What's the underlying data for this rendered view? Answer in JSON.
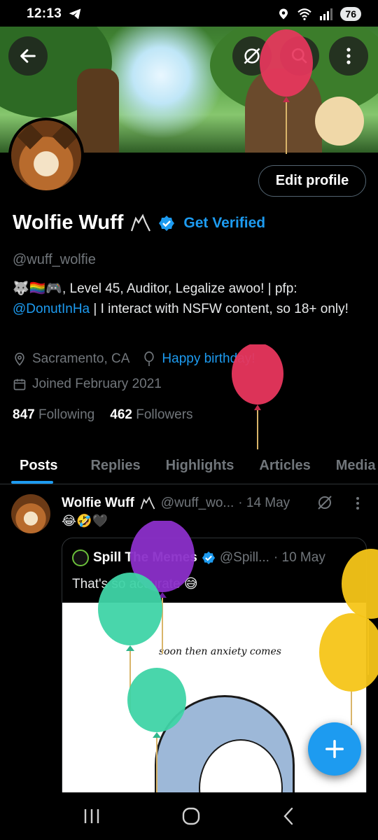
{
  "status_bar": {
    "time": "12:13",
    "battery": "76",
    "signal_label": "5"
  },
  "profile": {
    "display_name": "Wolfie Wuff",
    "get_verified": "Get Verified",
    "handle": "@wuff_wolfie",
    "bio_emojis": "🐺🏳️‍🌈🎮",
    "bio_text_1": ", Level 45, Auditor, Legalize awoo! | pfp:",
    "bio_link": "@DonutInHa",
    "bio_text_2": " | I interact with NSFW content, so 18+ only!",
    "location": "Sacramento, CA",
    "birthday_text": "Happy birthday!",
    "joined": "Joined February 2021",
    "following_count": "847",
    "following_label": "Following",
    "followers_count": "462",
    "followers_label": "Followers",
    "edit_profile": "Edit profile"
  },
  "tabs": [
    {
      "label": "Posts",
      "active": true
    },
    {
      "label": "Replies",
      "active": false
    },
    {
      "label": "Highlights",
      "active": false
    },
    {
      "label": "Articles",
      "active": false
    },
    {
      "label": "Media",
      "active": false
    }
  ],
  "post": {
    "author_name": "Wolfie Wuff",
    "author_handle": "@wuff_wo...",
    "date": "· 14 May",
    "text": "😂🤣🖤",
    "quote": {
      "name": "Spill The Memes",
      "handle": "@Spill...",
      "date": "· 10 May",
      "text": "That's so accurate 😅",
      "meme_caption": "soon then anxiety comes"
    }
  },
  "colors": {
    "accent": "#1d9bf0",
    "background": "#000000",
    "muted": "#71767b",
    "balloon_pink": "#e8365d",
    "balloon_purple": "#8b2fc9",
    "balloon_teal": "#3fd4a6",
    "balloon_yellow": "#f5c518"
  }
}
